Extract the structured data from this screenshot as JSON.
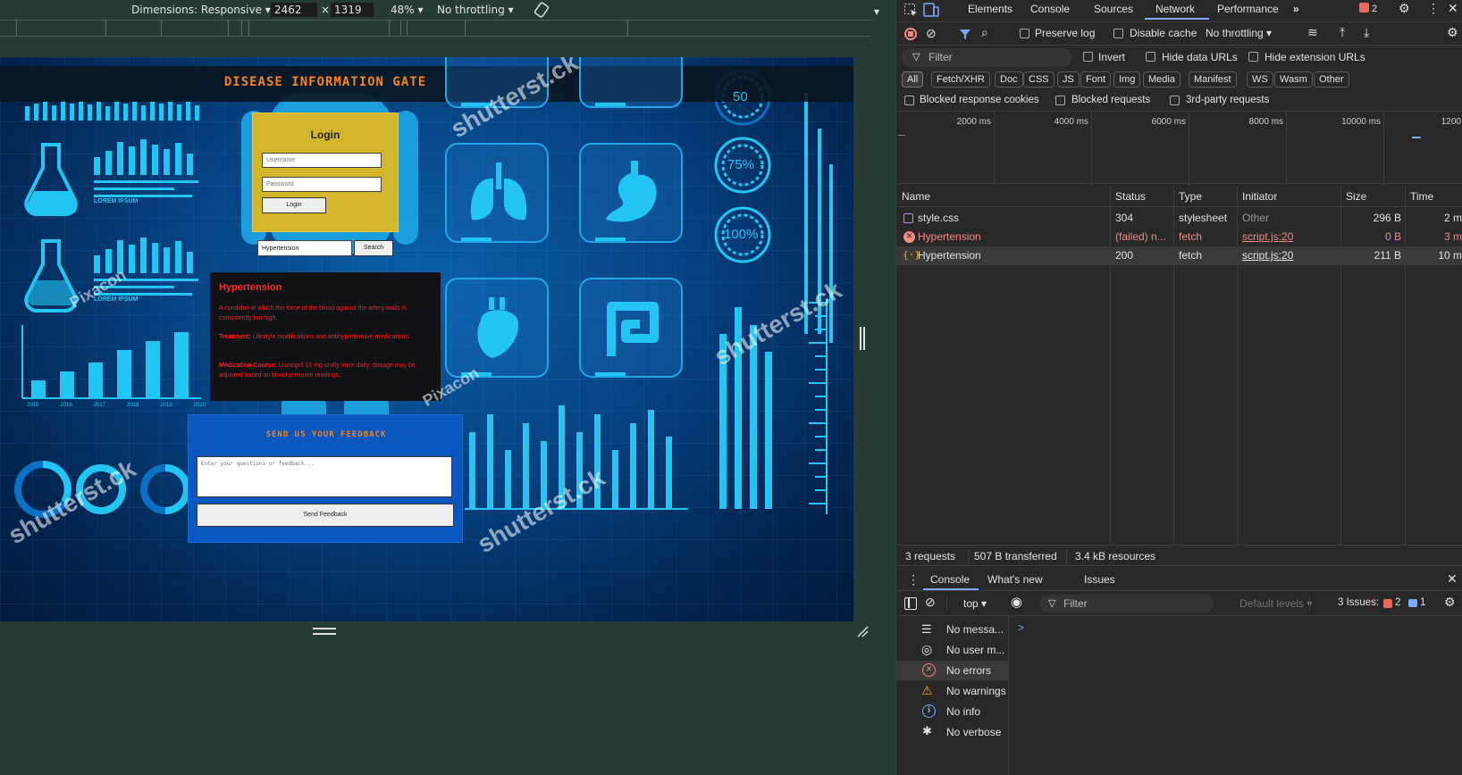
{
  "device_toolbar": {
    "dimensions_label": "Dimensions: Responsive",
    "width": "2462",
    "times": "×",
    "height": "1319",
    "zoom": "48%",
    "throttling": "No throttling"
  },
  "page": {
    "title": "DISEASE INFORMATION GATE",
    "login": {
      "heading": "Login",
      "username_placeholder": "Username",
      "password_placeholder": "Password",
      "button": "Login"
    },
    "search": {
      "value": "Hypertension",
      "button": "Search"
    },
    "disease": {
      "name": "Hypertension",
      "description": "A condition in which the force of the blood against the artery walls is consistently too high.",
      "treatment_label": "Treatment:",
      "treatment": "Lifestyle modifications and antihypertensive medications.",
      "medication_label": "Medication Course:",
      "medication": "Lisinopril 10 mg orally once daily; dosage may be adjusted based on blood pressure readings."
    },
    "feedback": {
      "heading": "SEND US YOUR FEEDBACK",
      "placeholder": "Enter your questions or feedback...",
      "button": "Send Feedback"
    },
    "background": {
      "lorem1": "LOREM IPSUM",
      "lorem2": "LOREM IPSUM",
      "gauges": [
        "50",
        "75%",
        "100%"
      ],
      "years": [
        "2015",
        "2016",
        "2017",
        "2018",
        "2019",
        "2020"
      ],
      "watermarks": [
        "shutterst.ck",
        "Pixacon",
        "shutterst.ck",
        "shutterst.ck",
        "Pixacon",
        "shutterst.ck"
      ]
    }
  },
  "devtools": {
    "tabs": [
      "Elements",
      "Console",
      "Sources",
      "Network",
      "Performance"
    ],
    "active_tab": "Network",
    "issues_count": "2",
    "preserve_log": "Preserve log",
    "disable_cache": "Disable cache",
    "throttling": "No throttling",
    "filter_placeholder": "Filter",
    "invert": "Invert",
    "hide_data_urls": "Hide data URLs",
    "hide_extension_urls": "Hide extension URLs",
    "type_filters": [
      "All",
      "Fetch/XHR",
      "Doc",
      "CSS",
      "JS",
      "Font",
      "Img",
      "Media",
      "Manifest",
      "WS",
      "Wasm",
      "Other"
    ],
    "blocked_cookies": "Blocked response cookies",
    "blocked_requests": "Blocked requests",
    "third_party": "3rd-party requests",
    "timeline_ticks": [
      "2000 ms",
      "4000 ms",
      "6000 ms",
      "8000 ms",
      "10000 ms",
      "1200"
    ],
    "columns": [
      "Name",
      "Status",
      "Type",
      "Initiator",
      "Size",
      "Time"
    ],
    "requests": [
      {
        "name": "style.css",
        "status": "304",
        "type": "stylesheet",
        "initiator": "Other",
        "size": "296 B",
        "time": "2 m"
      },
      {
        "name": "Hypertension",
        "status": "(failed) n...",
        "type": "fetch",
        "initiator": "script.js:20",
        "size": "0 B",
        "time": "3 m"
      },
      {
        "name": "Hypertension",
        "status": "200",
        "type": "fetch",
        "initiator": "script.js:20",
        "size": "211 B",
        "time": "10 m"
      }
    ],
    "summary": {
      "requests": "3 requests",
      "transferred": "507 B transferred",
      "resources": "3.4 kB resources"
    },
    "drawer_tabs": [
      "Console",
      "What's new",
      "Issues"
    ],
    "console": {
      "context": "top",
      "filter_placeholder": "Filter",
      "levels": "Default levels",
      "issues_label": "3 Issues:",
      "issues_warn": "2",
      "issues_info": "1",
      "prompt": ">",
      "sidebar": [
        "No messa...",
        "No user m...",
        "No errors",
        "No warnings",
        "No info",
        "No verbose"
      ]
    }
  }
}
